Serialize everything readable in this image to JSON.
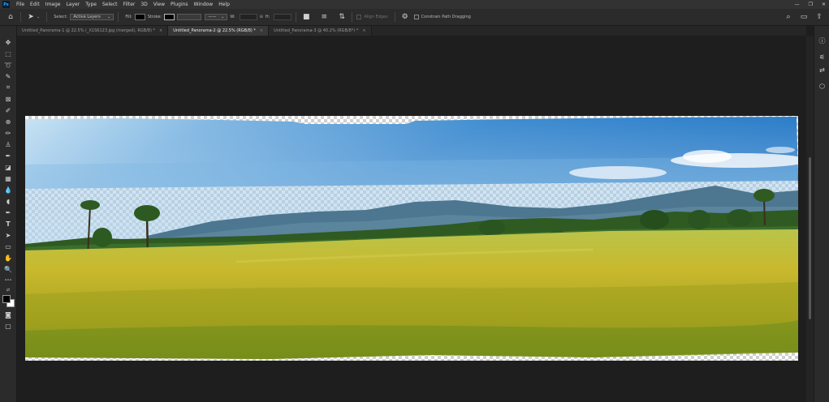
{
  "menu": {
    "app_icon": "Ps",
    "items": [
      "File",
      "Edit",
      "Image",
      "Layer",
      "Type",
      "Select",
      "Filter",
      "3D",
      "View",
      "Plugins",
      "Window",
      "Help"
    ],
    "window_controls": [
      "—",
      "❐",
      "✕"
    ]
  },
  "options": {
    "select_label": "Select:",
    "select_value": "Active Layers",
    "fill_label": "Fill:",
    "stroke_label": "Stroke:",
    "w_label": "W:",
    "h_label": "H:",
    "align_edges_label": "Align Edges",
    "constrain_label": "Constrain Path Dragging",
    "fill_color": "#000000",
    "stroke_color": "#000000"
  },
  "tabs": [
    {
      "label": "Untitled_Panorama-1 @ 22.5% (_X1S6123.jpg (merged), RGB/8) *",
      "active": false
    },
    {
      "label": "Untitled_Panorama-2 @ 22.5% (RGB/8) *",
      "active": true
    },
    {
      "label": "Untitled_Panorama-3 @ 40.2% (RGB/8*) *",
      "active": false
    }
  ],
  "tab_close": "×",
  "tools": [
    {
      "name": "move-tool",
      "glyph": "✥"
    },
    {
      "name": "marquee-tool",
      "glyph": "⬚"
    },
    {
      "name": "lasso-tool",
      "glyph": "➰"
    },
    {
      "name": "quick-selection-tool",
      "glyph": "✎"
    },
    {
      "name": "crop-tool",
      "glyph": "⌗"
    },
    {
      "name": "frame-tool",
      "glyph": "⊠"
    },
    {
      "name": "eyedropper-tool",
      "glyph": "✐"
    },
    {
      "name": "healing-brush-tool",
      "glyph": "⊕"
    },
    {
      "name": "brush-tool",
      "glyph": "✏"
    },
    {
      "name": "clone-stamp-tool",
      "glyph": "♙"
    },
    {
      "name": "history-brush-tool",
      "glyph": "✒"
    },
    {
      "name": "eraser-tool",
      "glyph": "◪"
    },
    {
      "name": "gradient-tool",
      "glyph": "▦"
    },
    {
      "name": "blur-tool",
      "glyph": "💧"
    },
    {
      "name": "dodge-tool",
      "glyph": "◖"
    },
    {
      "name": "pen-tool",
      "glyph": "✒"
    },
    {
      "name": "type-tool",
      "glyph": "T"
    },
    {
      "name": "path-selection-tool",
      "glyph": "➤"
    },
    {
      "name": "rectangle-tool",
      "glyph": "▭"
    },
    {
      "name": "hand-tool",
      "glyph": "✋"
    },
    {
      "name": "zoom-tool",
      "glyph": "🔍"
    },
    {
      "name": "more-tools",
      "glyph": "•••"
    }
  ],
  "bottom_tools": [
    {
      "name": "quick-mask-icon",
      "glyph": "◙"
    },
    {
      "name": "screen-mode-icon",
      "glyph": "▢"
    }
  ],
  "right_icons": [
    {
      "name": "learn-icon",
      "glyph": "ⓘ"
    },
    {
      "name": "brush-settings-icon",
      "glyph": "⚟"
    },
    {
      "name": "adjustments-icon",
      "glyph": "⇄"
    },
    {
      "name": "libraries-icon",
      "glyph": "⬡"
    }
  ],
  "top_right_icons": [
    {
      "name": "search-icon",
      "glyph": "⌕"
    },
    {
      "name": "workspace-icon",
      "glyph": "▭"
    },
    {
      "name": "share-icon",
      "glyph": "⇧"
    }
  ]
}
